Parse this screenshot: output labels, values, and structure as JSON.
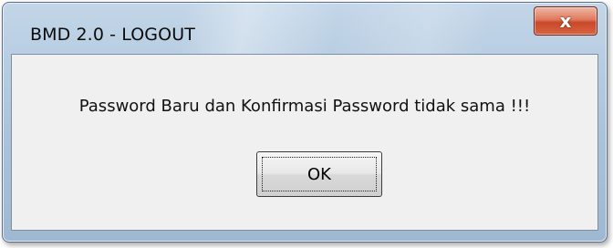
{
  "dialog": {
    "title": "BMD 2.0 - LOGOUT",
    "close_icon": "close-icon",
    "close_glyph": "x",
    "message": "Password Baru dan Konfirmasi Password tidak sama !!!",
    "ok_label": "OK"
  },
  "colors": {
    "close_button": "#c9492b",
    "frame": "#a9c1d9",
    "client_bg": "#f0f0f0"
  }
}
